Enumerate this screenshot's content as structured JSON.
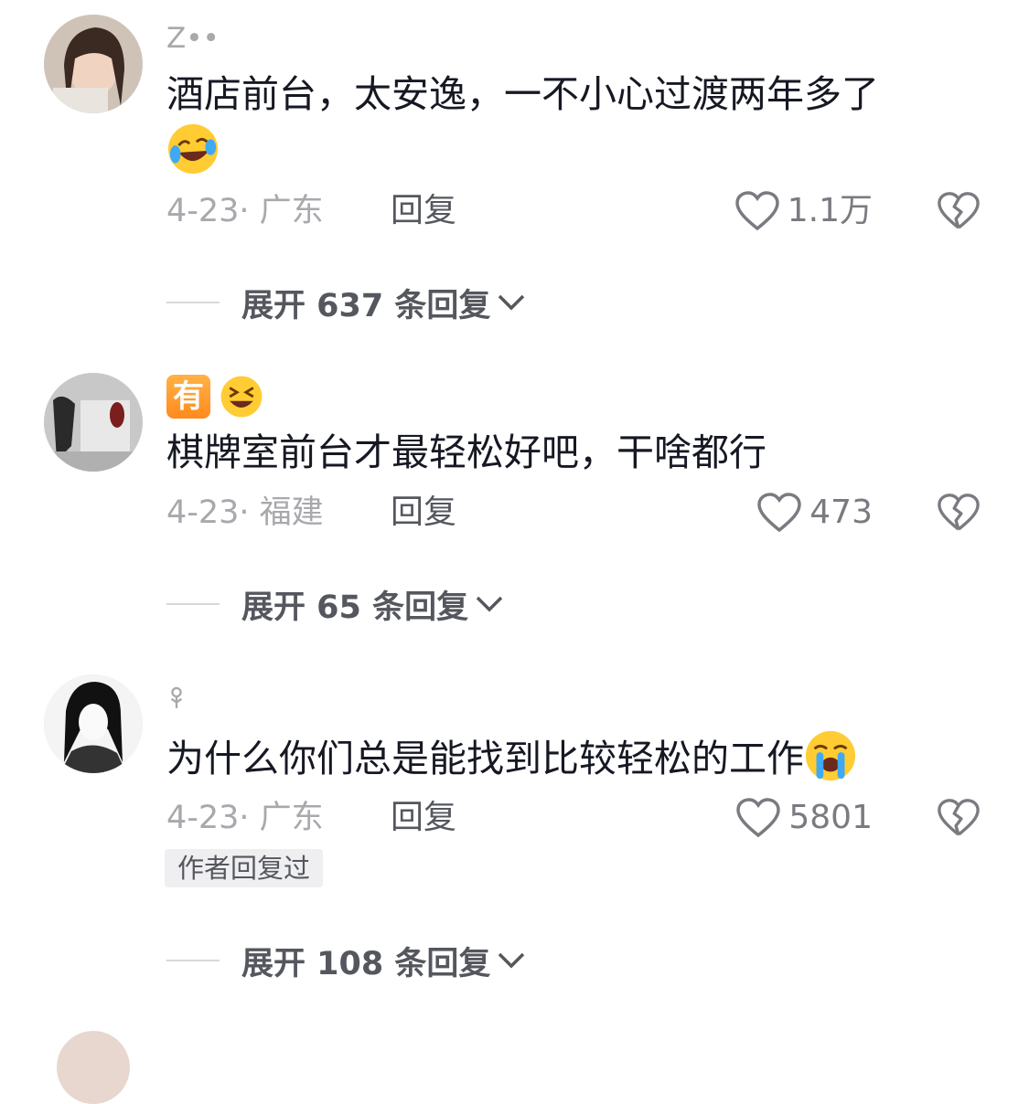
{
  "comments": [
    {
      "username": "Z••",
      "content": "酒店前台，太安逸，一不小心过渡两年多了",
      "emoji": "rolling-laughing-emoji",
      "date_location": "4-23· 广东",
      "reply_label": "回复",
      "likes": "1.1万",
      "expand_label": "展开 637 条回复"
    },
    {
      "username_badge": "有",
      "username_emoji": "grinning-squint-emoji",
      "content": "棋牌室前台才最轻松好吧，干啥都行",
      "date_location": "4-23· 福建",
      "reply_label": "回复",
      "likes": "473",
      "expand_label": "展开 65 条回复"
    },
    {
      "username_icon": "flower-icon",
      "content": "为什么你们总是能找到比较轻松的工作",
      "emoji": "crying-emoji",
      "date_location": "4-23· 广东",
      "reply_label": "回复",
      "likes": "5801",
      "author_replied": "作者回复过",
      "expand_label": "展开 108 条回复"
    }
  ],
  "colors": {
    "text": "#161823",
    "muted": "#a8a8ad",
    "secondary": "#55575e",
    "badge_bg": "#efeff1"
  }
}
